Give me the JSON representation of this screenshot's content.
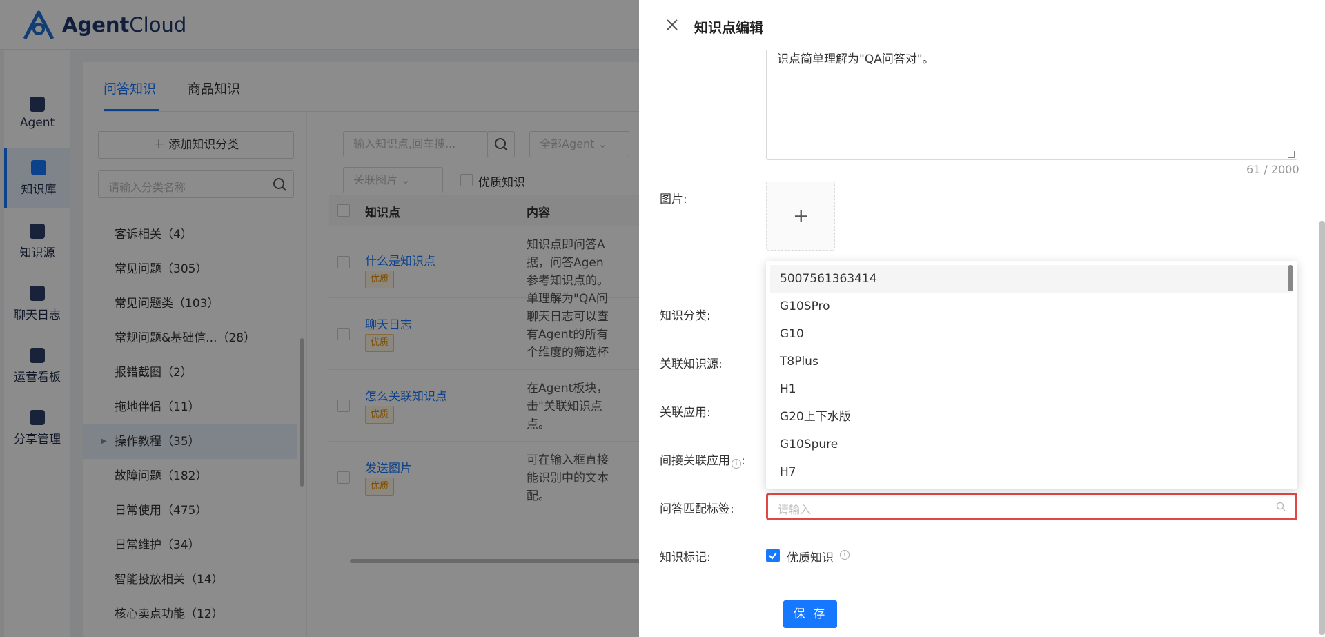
{
  "app": {
    "logo_bold": "Agent",
    "logo_light": "Cloud"
  },
  "nav": [
    {
      "label": "Agent"
    },
    {
      "label": "知识库"
    },
    {
      "label": "知识源"
    },
    {
      "label": "聊天日志"
    },
    {
      "label": "运营看板"
    },
    {
      "label": "分享管理"
    }
  ],
  "tabs": [
    {
      "label": "问答知识"
    },
    {
      "label": "商品知识"
    }
  ],
  "categories": {
    "add_label": "添加知识分类",
    "search_placeholder": "请输入分类名称",
    "items": [
      "客诉相关（4）",
      "常见问题（305）",
      "常见问题类（103）",
      "常规问题&基础信...（28）",
      "报错截图（2）",
      "拖地伴侣（11）",
      "操作教程（35）",
      "故障问题（182）",
      "日常使用（475）",
      "日常维护（34）",
      "智能投放相关（14）",
      "核心卖点功能（12）"
    ]
  },
  "list": {
    "search_placeholder": "输入知识点,回车搜...",
    "agent_filter": "全部Agent",
    "image_filter": "关联图片",
    "quality_filter": "优质知识",
    "col_title": "知识点",
    "col_content": "内容",
    "rows": [
      {
        "title": "什么是知识点",
        "badge": "优质",
        "content": [
          "知识点即问答A",
          "据，问答Agen",
          "参考知识点的。",
          "单理解为\"QA问"
        ]
      },
      {
        "title": "聊天日志",
        "badge": "优质",
        "content": [
          "聊天日志可以查",
          "有Agent的所有",
          "个维度的筛选杯"
        ]
      },
      {
        "title": "怎么关联知识点",
        "badge": "优质",
        "content": [
          "在Agent板块，",
          "击\"关联知识点",
          "点。"
        ]
      },
      {
        "title": "发送图片",
        "badge": "优质",
        "content": [
          "可在输入框直接",
          "能识别中的文本",
          "配。"
        ]
      }
    ]
  },
  "drawer": {
    "title": "知识点编辑",
    "content_text": "识点简单理解为\"QA问答对\"。",
    "char_count": "61 / 2000",
    "label_image": "图片:",
    "label_category": "知识分类:",
    "label_source": "关联知识源:",
    "label_app": "关联应用:",
    "label_indirect_app": "间接关联应用",
    "label_colon": ":",
    "label_tags": "问答匹配标签:",
    "tags_placeholder": "请输入",
    "label_mark": "知识标记:",
    "mark_checkbox_label": "优质知识",
    "save_label": "保 存",
    "dropdown_options": [
      "5007561363414",
      "G10SPro",
      "G10",
      "T8Plus",
      "H1",
      "G20上下水版",
      "G10Spure",
      "H7"
    ]
  },
  "colors": {
    "primary": "#1677ff",
    "highlight_border": "#e04646",
    "badge": "#e88b00"
  }
}
